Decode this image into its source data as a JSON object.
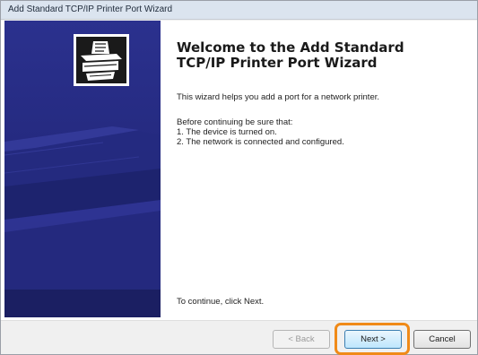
{
  "window": {
    "title": "Add Standard TCP/IP Printer Port Wizard"
  },
  "main": {
    "heading_line1": "Welcome to the Add Standard",
    "heading_line2": "TCP/IP Printer Port Wizard",
    "intro": "This wizard helps you add a port for a network printer.",
    "before_label": "Before continuing be sure that:",
    "item1": "1.  The device is turned on.",
    "item2": "2.  The network is connected and configured.",
    "continue_text": "To continue, click Next."
  },
  "footer": {
    "back_label": "< Back",
    "next_label": "Next >",
    "cancel_label": "Cancel",
    "back_enabled": false,
    "highlight_color": "#f08a18"
  },
  "colors": {
    "sidebar": "#2b318e",
    "titlebar": "#dbe4ef"
  },
  "icons": {
    "wizard": "printer-wizard-icon",
    "sidebar_art": "printer-illustration"
  }
}
